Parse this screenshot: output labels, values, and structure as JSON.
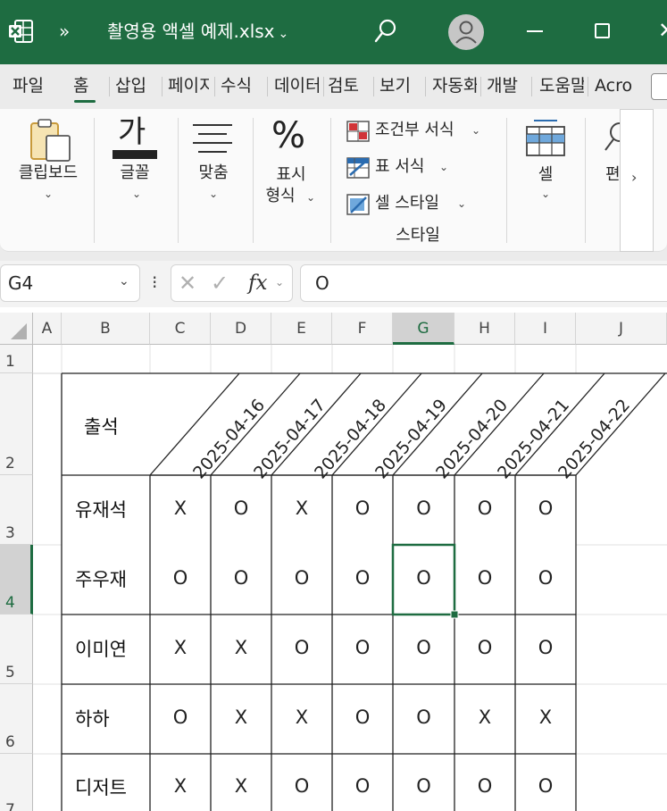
{
  "window": {
    "title": "촬영용 액셀 예제.xlsx",
    "qat_label": "»",
    "brand_color": "#1e6c41"
  },
  "ribbon_tabs": [
    "파일",
    "홈",
    "삽입",
    "페이지",
    "수식",
    "데이터",
    "검토",
    "보기",
    "자동화",
    "개발",
    "도움말",
    "Acro"
  ],
  "ribbon_active_tab": "홈",
  "ribbon": {
    "clipboard": "클립보드",
    "font_glyph": "가",
    "font": "글꼴",
    "align": "맞춤",
    "number_symbol": "%",
    "number_l1": "표시",
    "number_l2": "형식",
    "styles": {
      "conditional": "조건부 서식",
      "table_format": "표 서식",
      "cell_styles": "셀 스타일",
      "group_label": "스타일"
    },
    "cells": "셀",
    "editing": "편",
    "more": "›"
  },
  "formula_bar": {
    "name_box": "G4",
    "dots": "⁝",
    "fx": "fx",
    "value": "O"
  },
  "grid": {
    "columns": [
      "A",
      "B",
      "C",
      "D",
      "E",
      "F",
      "G",
      "H",
      "I",
      "J"
    ],
    "selected_column": "G",
    "rows": [
      "1",
      "2",
      "3",
      "4",
      "5",
      "6",
      "7"
    ],
    "selected_row": "4",
    "header_label": "출석",
    "dates": [
      "2025-04-16",
      "2025-04-17",
      "2025-04-18",
      "2025-04-19",
      "2025-04-20",
      "2025-04-21",
      "2025-04-22"
    ],
    "people": [
      {
        "name": "유재석",
        "marks": [
          "X",
          "O",
          "X",
          "O",
          "O",
          "O",
          "O"
        ]
      },
      {
        "name": "주우재",
        "marks": [
          "O",
          "O",
          "O",
          "O",
          "O",
          "O",
          "O"
        ]
      },
      {
        "name": "이미연",
        "marks": [
          "X",
          "X",
          "O",
          "O",
          "O",
          "O",
          "O"
        ]
      },
      {
        "name": "하하",
        "marks": [
          "O",
          "X",
          "X",
          "O",
          "O",
          "X",
          "X"
        ]
      },
      {
        "name": "디저트",
        "marks": [
          "X",
          "X",
          "O",
          "O",
          "O",
          "O",
          "O"
        ]
      }
    ]
  }
}
